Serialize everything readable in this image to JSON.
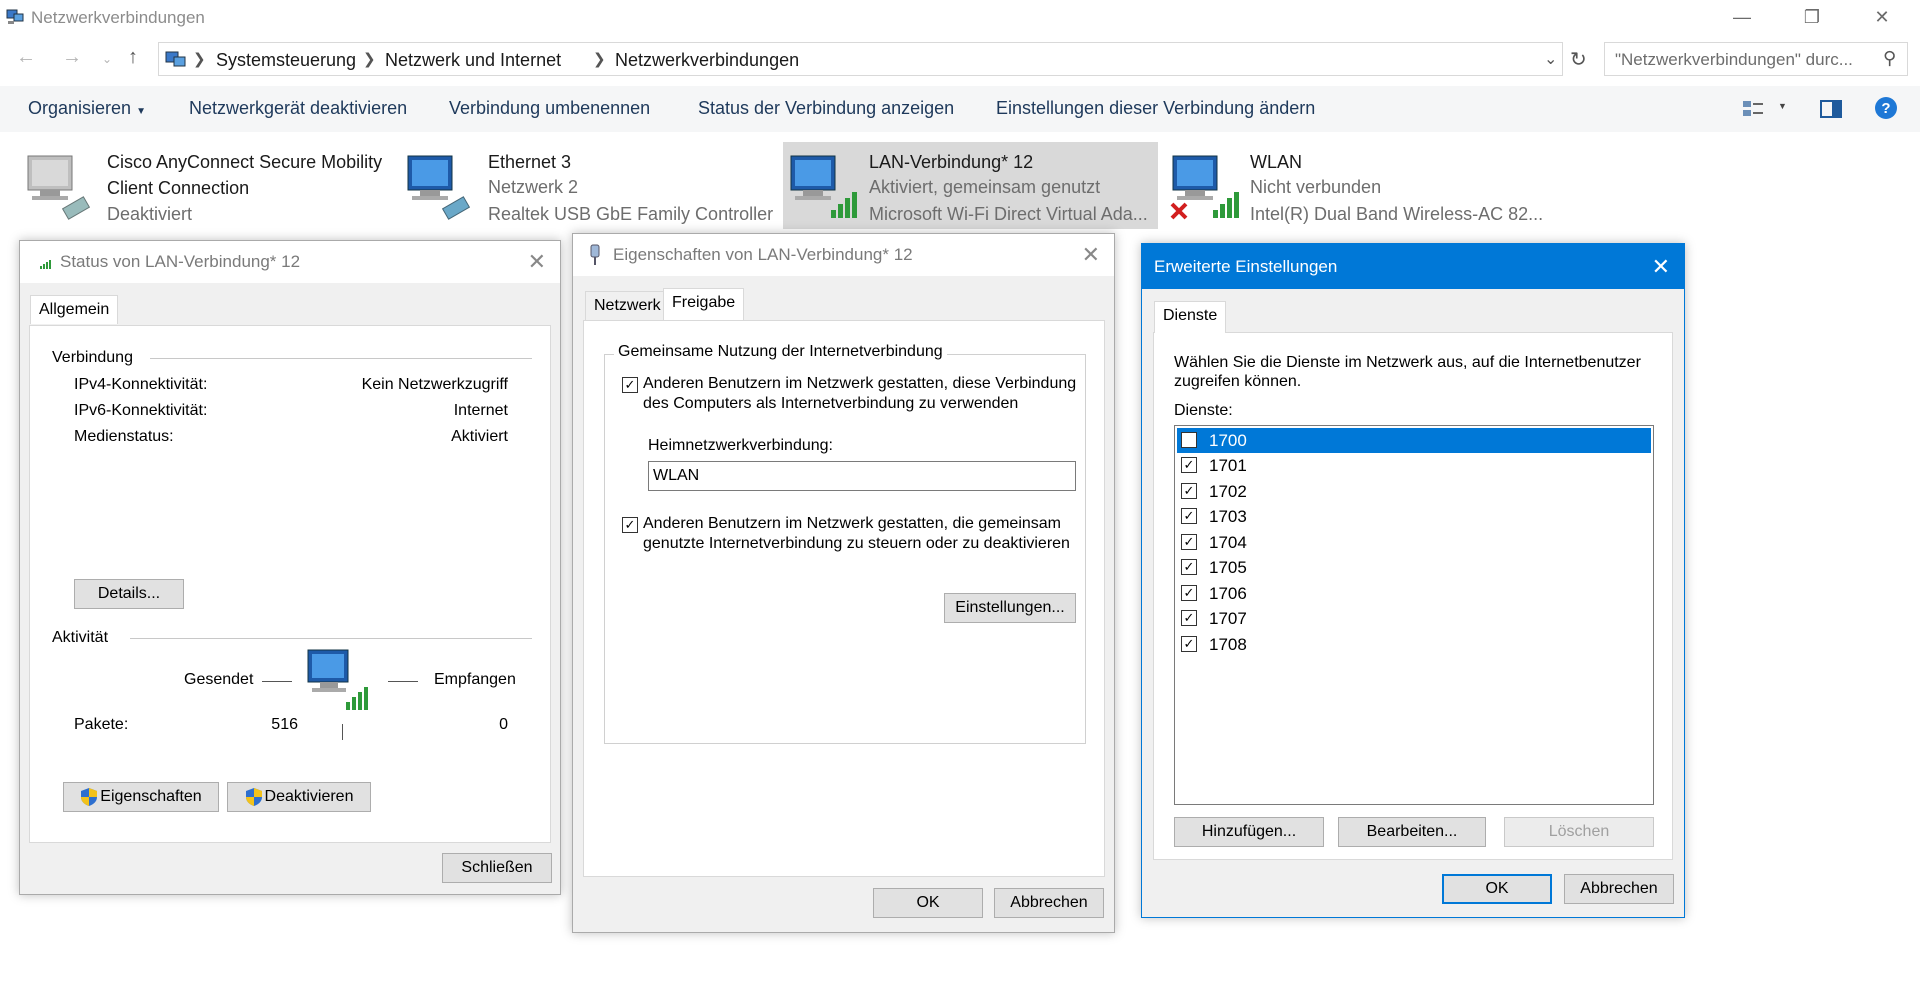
{
  "window": {
    "title": "Netzwerkverbindungen",
    "minimize_glyph": "—",
    "restore_glyph": "❐",
    "close_glyph": "✕"
  },
  "address": {
    "crumbs": [
      "Systemsteuerung",
      "Netzwerk und Internet",
      "Netzwerkverbindungen"
    ],
    "search_placeholder": "\"Netzwerkverbindungen\" durc..."
  },
  "commands": {
    "organize": "Organisieren",
    "disable": "Netzwerkgerät deaktivieren",
    "rename": "Verbindung umbenennen",
    "status": "Status der Verbindung anzeigen",
    "settings": "Einstellungen dieser Verbindung ändern"
  },
  "adapters": [
    {
      "name_line1": "Cisco AnyConnect Secure Mobility",
      "name_line2": "Client Connection",
      "status": "Deaktiviert",
      "device": "",
      "icon": "network-adapter-disabled-icon"
    },
    {
      "name_line1": "Ethernet 3",
      "status": "Netzwerk 2",
      "device": "Realtek USB GbE Family Controller",
      "icon": "network-adapter-icon"
    },
    {
      "name_line1": "LAN-Verbindung* 12",
      "status": "Aktiviert, gemeinsam genutzt",
      "device": "Microsoft Wi-Fi Direct Virtual Ada...",
      "icon": "wifi-adapter-icon"
    },
    {
      "name_line1": "WLAN",
      "status": "Nicht verbunden",
      "device": "Intel(R) Dual Band Wireless-AC 82...",
      "icon": "wifi-adapter-disconnected-icon"
    }
  ],
  "status_dialog": {
    "title": "Status von LAN-Verbindung* 12",
    "tab": "Allgemein",
    "connection_header": "Verbindung",
    "rows": [
      {
        "label": "IPv4-Konnektivität:",
        "value": "Kein Netzwerkzugriff"
      },
      {
        "label": "IPv6-Konnektivität:",
        "value": "Internet"
      },
      {
        "label": "Medienstatus:",
        "value": "Aktiviert"
      }
    ],
    "details_button": "Details...",
    "activity_header": "Aktivität",
    "sent_label": "Gesendet",
    "received_label": "Empfangen",
    "packets_label": "Pakete:",
    "packets_sent": "516",
    "packets_received": "0",
    "properties_button": "Eigenschaften",
    "deactivate_button": "Deaktivieren",
    "close_button": "Schließen"
  },
  "properties_dialog": {
    "title": "Eigenschaften von LAN-Verbindung* 12",
    "tabs": [
      "Netzwerk",
      "Freigabe"
    ],
    "group_title": "Gemeinsame Nutzung der Internetverbindung",
    "allow_share_line1": "Anderen Benutzern im Netzwerk gestatten, diese Verbindung",
    "allow_share_line2": "des Computers als Internetverbindung zu verwenden",
    "allow_share_checked": true,
    "home_label": "Heimnetzwerkverbindung:",
    "home_value": "WLAN",
    "allow_control_line1": "Anderen Benutzern im Netzwerk gestatten, die gemeinsam",
    "allow_control_line2": "genutzte Internetverbindung zu steuern oder zu deaktivieren",
    "allow_control_checked": true,
    "settings_button": "Einstellungen...",
    "ok_button": "OK",
    "cancel_button": "Abbrechen"
  },
  "advanced_dialog": {
    "title": "Erweiterte Einstellungen",
    "tab": "Dienste",
    "instruction_line1": "Wählen Sie die Dienste im Netzwerk aus, auf die Internetbenutzer",
    "instruction_line2": "zugreifen können.",
    "services_label": "Dienste:",
    "services": [
      "1700",
      "1701",
      "1702",
      "1703",
      "1704",
      "1705",
      "1706",
      "1707",
      "1708"
    ],
    "selected_service": "1700",
    "add_button": "Hinzufügen...",
    "edit_button": "Bearbeiten...",
    "delete_button": "Löschen",
    "ok_button": "OK",
    "cancel_button": "Abbrechen",
    "accent_color": "#0078d7"
  }
}
